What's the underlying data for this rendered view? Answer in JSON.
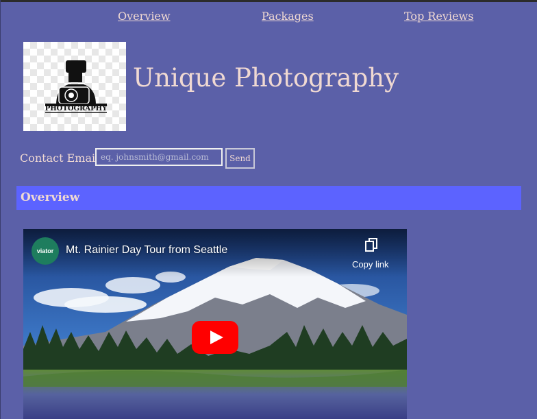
{
  "nav": {
    "overview": "Overview",
    "packages": "Packages",
    "top_reviews": "Top Reviews"
  },
  "logo": {
    "icon": "camera-photographer-icon",
    "text": "PHOTOGRAPHY"
  },
  "site_title": "Unique Photography",
  "contact": {
    "label": "Contact Email:",
    "placeholder": "eq. johnsmith@gmail.com",
    "send_label": "Send"
  },
  "section": {
    "title": "Overview"
  },
  "video": {
    "channel": "viator",
    "title": "Mt. Rainier Day Tour from Seattle",
    "copy_link_label": "Copy link"
  },
  "colors": {
    "background": "#5b60a8",
    "section_bar": "#5c63ff",
    "text": "#f0d9d2",
    "play_button": "#ff0000"
  }
}
